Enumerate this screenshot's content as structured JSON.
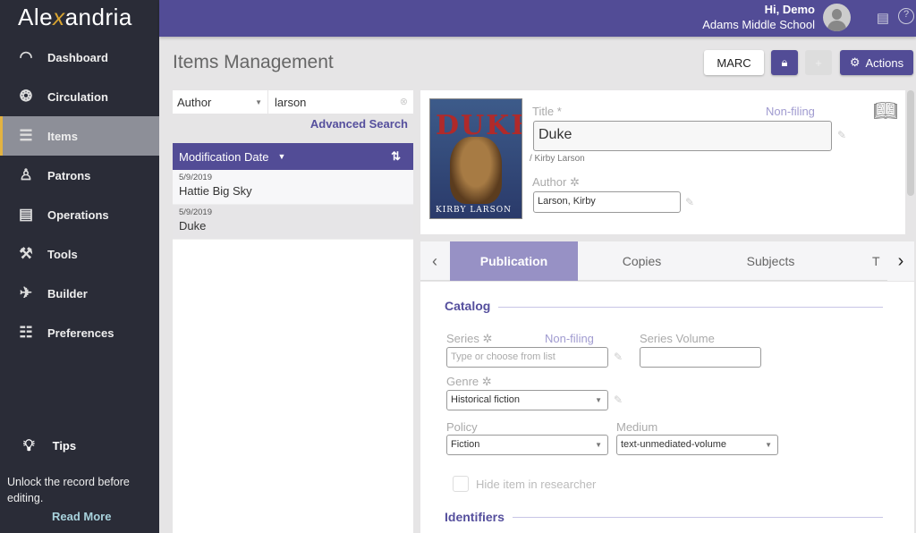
{
  "app": {
    "logo": "Alexandria"
  },
  "sidebar": {
    "items": [
      {
        "label": "Dashboard",
        "icon": "gauge-icon"
      },
      {
        "label": "Circulation",
        "icon": "circulation-icon"
      },
      {
        "label": "Items",
        "icon": "books-icon",
        "active": true
      },
      {
        "label": "Patrons",
        "icon": "patrons-icon"
      },
      {
        "label": "Operations",
        "icon": "clipboard-icon"
      },
      {
        "label": "Tools",
        "icon": "toolbox-icon"
      },
      {
        "label": "Builder",
        "icon": "rocket-icon"
      },
      {
        "label": "Preferences",
        "icon": "sliders-icon"
      }
    ],
    "tips": {
      "label": "Tips",
      "text": "Unlock the record before editing.",
      "read_more": "Read More"
    }
  },
  "header": {
    "greeting": "Hi, Demo",
    "school": "Adams Middle School"
  },
  "page": {
    "title": "Items Management"
  },
  "toolbar": {
    "marc": "MARC",
    "actions": "Actions"
  },
  "search": {
    "field": "Author",
    "query": "larson",
    "advanced": "Advanced Search"
  },
  "list": {
    "sort_label": "Modification Date",
    "rows": [
      {
        "date": "5/9/2019",
        "title": "Hattie Big Sky"
      },
      {
        "date": "5/9/2019",
        "title": "Duke"
      }
    ]
  },
  "record": {
    "cover": {
      "title_text": "DUKE",
      "author_text": "KIRBY LARSON"
    },
    "title_label": "Title *",
    "non_filing": "Non-filing",
    "title": "Duke",
    "statement": "/ Kirby Larson",
    "author_label": "Author",
    "author": "Larson, Kirby"
  },
  "tabs": [
    "Publication",
    "Copies",
    "Subjects",
    "T"
  ],
  "catalog": {
    "heading": "Catalog",
    "series_label": "Series",
    "series_nonfiling": "Non-filing",
    "series_placeholder": "Type or choose from list",
    "series_volume_label": "Series Volume",
    "genre_label": "Genre",
    "genre": "Historical fiction",
    "policy_label": "Policy",
    "policy": "Fiction",
    "medium_label": "Medium",
    "medium": "text-unmediated-volume",
    "hide_label": "Hide item in researcher"
  },
  "identifiers": {
    "heading": "Identifiers"
  },
  "colors": {
    "brand": "#524c96",
    "sidebar": "#2a2c37",
    "active_tab": "#9791c5",
    "accent": "#e3b341"
  }
}
